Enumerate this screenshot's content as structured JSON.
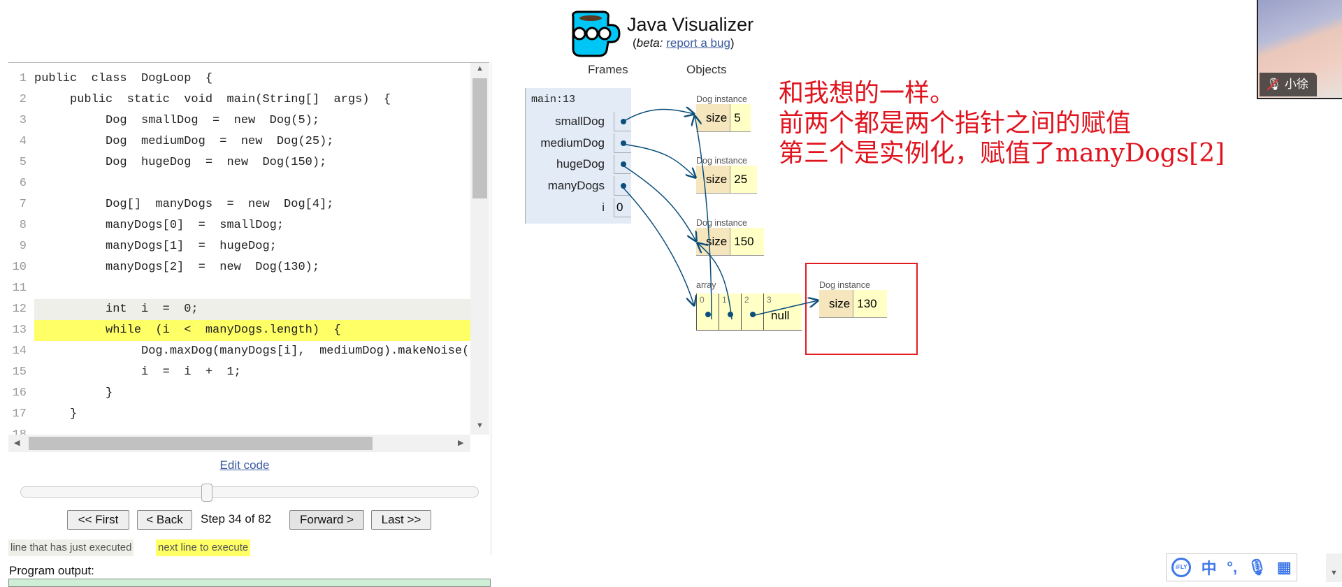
{
  "header": {
    "title": "Java Visualizer",
    "beta_prefix": "(",
    "beta": "beta:",
    "report_link": "report a bug",
    "beta_suffix": ")"
  },
  "columns": {
    "frames": "Frames",
    "objects": "Objects"
  },
  "code": {
    "lines": [
      {
        "n": "1",
        "text": "public  class  DogLoop  {"
      },
      {
        "n": "2",
        "text": "     public  static  void  main(String[]  args)  {"
      },
      {
        "n": "3",
        "text": "          Dog  smallDog  =  new  Dog(5);"
      },
      {
        "n": "4",
        "text": "          Dog  mediumDog  =  new  Dog(25);"
      },
      {
        "n": "5",
        "text": "          Dog  hugeDog  =  new  Dog(150);"
      },
      {
        "n": "6",
        "text": ""
      },
      {
        "n": "7",
        "text": "          Dog[]  manyDogs  =  new  Dog[4];"
      },
      {
        "n": "8",
        "text": "          manyDogs[0]  =  smallDog;"
      },
      {
        "n": "9",
        "text": "          manyDogs[1]  =  hugeDog;"
      },
      {
        "n": "10",
        "text": "          manyDogs[2]  =  new  Dog(130);"
      },
      {
        "n": "11",
        "text": ""
      },
      {
        "n": "12",
        "text": "          int  i  =  0;"
      },
      {
        "n": "13",
        "text": "          while  (i  <  manyDogs.length)  {"
      },
      {
        "n": "14",
        "text": "               Dog.maxDog(manyDogs[i],  mediumDog).makeNoise();"
      },
      {
        "n": "15",
        "text": "               i  =  i  +  1;"
      },
      {
        "n": "16",
        "text": "          }"
      },
      {
        "n": "17",
        "text": "     }"
      },
      {
        "n": "18",
        "text": ""
      }
    ],
    "just_executed_line": 12,
    "next_line": 13
  },
  "controls": {
    "edit_code": "Edit code",
    "first": "<< First",
    "back": "< Back",
    "step": "Step 34 of 82",
    "step_current": 34,
    "step_total": 82,
    "forward": "Forward >",
    "last": "Last >>"
  },
  "legend": {
    "prev": "line that has just executed",
    "next": "next line to execute"
  },
  "output": {
    "label": "Program output:"
  },
  "frame": {
    "name": "main:13",
    "vars": [
      {
        "name": "smallDog"
      },
      {
        "name": "mediumDog"
      },
      {
        "name": "hugeDog"
      },
      {
        "name": "manyDogs"
      },
      {
        "name": "i",
        "value": "0"
      }
    ]
  },
  "heap": {
    "dogs": [
      {
        "label": "Dog instance",
        "field": "size",
        "value": "5"
      },
      {
        "label": "Dog instance",
        "field": "size",
        "value": "25"
      },
      {
        "label": "Dog instance",
        "field": "size",
        "value": "150"
      },
      {
        "label": "Dog instance",
        "field": "size",
        "value": "130"
      }
    ],
    "array": {
      "label": "array",
      "indices": [
        "0",
        "1",
        "2",
        "3"
      ],
      "null_text": "null"
    }
  },
  "annotation": {
    "lines": [
      "和我想的一样。",
      "前两个都是两个指针之间的赋值",
      "第三个是实例化，赋值了manyDogs[2]"
    ],
    "color": "#e0141e"
  },
  "video": {
    "name": "小徐",
    "mic": "muted"
  },
  "ifly": {
    "badge": "iFLY",
    "lang": "中",
    "punct": "°,"
  },
  "colors": {
    "arrow": "#0c4e7a",
    "next_line": "#ffff66",
    "prev_line": "#efefea",
    "logo": "#00c6f5"
  }
}
